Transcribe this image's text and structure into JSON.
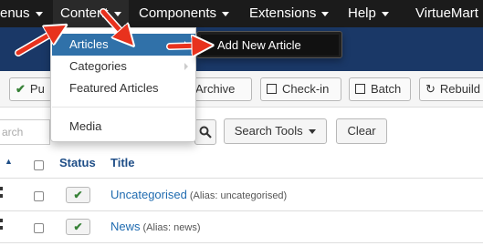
{
  "navbar": {
    "items": [
      {
        "label": "enus"
      },
      {
        "label": "Content"
      },
      {
        "label": "Components"
      },
      {
        "label": "Extensions"
      },
      {
        "label": "Help"
      },
      {
        "label": "VirtueMart"
      }
    ]
  },
  "toolbar": {
    "publish_label": "Pu",
    "archive_label": "Archive",
    "checkin_label": "Check-in",
    "batch_label": "Batch",
    "rebuild_label": "Rebuild"
  },
  "filter": {
    "search_placeholder": "arch",
    "search_tools_label": "Search Tools",
    "clear_label": "Clear"
  },
  "table": {
    "headers": {
      "status": "Status",
      "title": "Title"
    },
    "rows": [
      {
        "title": "Uncategorised",
        "alias": "(Alias: uncategorised)"
      },
      {
        "title": "News",
        "alias": "(Alias: news)"
      }
    ]
  },
  "content_menu": {
    "items": [
      {
        "label": "Articles"
      },
      {
        "label": "Categories"
      },
      {
        "label": "Featured Articles"
      },
      {
        "label": "Media"
      }
    ]
  },
  "articles_submenu": {
    "item_label": "Add New Article"
  },
  "colors": {
    "navbar": "#1b1b1b",
    "subhead": "#1a3867",
    "menu_active": "#3071a9",
    "link": "#1f6bb0",
    "annotation_arrow": "#e8321d"
  }
}
